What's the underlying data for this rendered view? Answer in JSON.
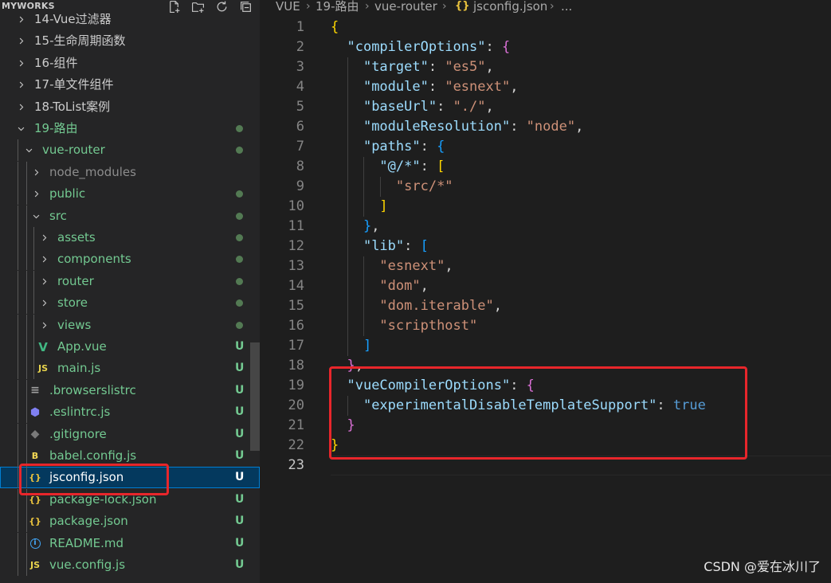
{
  "explorer": {
    "title": "MYWORKS",
    "actions": [
      "new-file-icon",
      "new-folder-icon",
      "refresh-icon",
      "collapse-all-icon"
    ],
    "items": [
      {
        "label": "14-Vue过滤器",
        "kind": "folder",
        "expanded": false,
        "level": 1,
        "status": ""
      },
      {
        "label": "15-生命周期函数",
        "kind": "folder",
        "expanded": false,
        "level": 1,
        "status": ""
      },
      {
        "label": "16-组件",
        "kind": "folder",
        "expanded": false,
        "level": 1,
        "status": ""
      },
      {
        "label": "17-单文件组件",
        "kind": "folder",
        "expanded": false,
        "level": 1,
        "status": ""
      },
      {
        "label": "18-ToList案例",
        "kind": "folder",
        "expanded": false,
        "level": 1,
        "status": ""
      },
      {
        "label": "19-路由",
        "kind": "folder",
        "expanded": true,
        "level": 1,
        "status": "dot"
      },
      {
        "label": "vue-router",
        "kind": "folder",
        "expanded": true,
        "level": 2,
        "status": "dot"
      },
      {
        "label": "node_modules",
        "kind": "folder",
        "expanded": false,
        "level": 3,
        "status": ""
      },
      {
        "label": "public",
        "kind": "folder",
        "expanded": false,
        "level": 3,
        "status": "dot"
      },
      {
        "label": "src",
        "kind": "folder",
        "expanded": true,
        "level": 3,
        "status": "dot"
      },
      {
        "label": "assets",
        "kind": "folder",
        "expanded": false,
        "level": 4,
        "status": "dot"
      },
      {
        "label": "components",
        "kind": "folder",
        "expanded": false,
        "level": 4,
        "status": "dot"
      },
      {
        "label": "router",
        "kind": "folder",
        "expanded": false,
        "level": 4,
        "status": "dot"
      },
      {
        "label": "store",
        "kind": "folder",
        "expanded": false,
        "level": 4,
        "status": "dot"
      },
      {
        "label": "views",
        "kind": "folder",
        "expanded": false,
        "level": 4,
        "status": "dot"
      },
      {
        "label": "App.vue",
        "kind": "file",
        "icon": "vue",
        "icon_text": "V",
        "level": 4,
        "status": "U"
      },
      {
        "label": "main.js",
        "kind": "file",
        "icon": "js",
        "icon_text": "JS",
        "level": 4,
        "status": "U"
      },
      {
        "label": ".browserslistrc",
        "kind": "file",
        "icon": "lines",
        "icon_text": "≡",
        "level": 3,
        "status": "U"
      },
      {
        "label": ".eslintrc.js",
        "kind": "file",
        "icon": "eslint",
        "icon_text": "⬢",
        "level": 3,
        "status": "U"
      },
      {
        "label": ".gitignore",
        "kind": "file",
        "icon": "git",
        "icon_text": "◆",
        "level": 3,
        "status": "U"
      },
      {
        "label": "babel.config.js",
        "kind": "file",
        "icon": "babel",
        "icon_text": "B",
        "level": 3,
        "status": "U"
      },
      {
        "label": "jsconfig.json",
        "kind": "file",
        "icon": "json",
        "icon_text": "{}",
        "level": 3,
        "status": "U",
        "selected": true
      },
      {
        "label": "package-lock.json",
        "kind": "file",
        "icon": "json",
        "icon_text": "{}",
        "level": 3,
        "status": "U"
      },
      {
        "label": "package.json",
        "kind": "file",
        "icon": "json",
        "icon_text": "{}",
        "level": 3,
        "status": "U"
      },
      {
        "label": "README.md",
        "kind": "file",
        "icon": "info",
        "icon_text": "i",
        "level": 3,
        "status": "U"
      },
      {
        "label": "vue.config.js",
        "kind": "file",
        "icon": "js",
        "icon_text": "JS",
        "level": 3,
        "status": "U"
      }
    ]
  },
  "breadcrumb": {
    "segments": [
      "VUE",
      "19-路由",
      "vue-router",
      "jsconfig.json",
      "..."
    ],
    "file_icon_text": "{}"
  },
  "editor": {
    "active_line": 23,
    "lines": [
      [
        [
          "{",
          "b1"
        ]
      ],
      [
        [
          "  ",
          "sp"
        ],
        [
          "\"compilerOptions\"",
          "key"
        ],
        [
          ": ",
          "punc"
        ],
        [
          "{",
          "b2"
        ]
      ],
      [
        [
          "    ",
          "sp"
        ],
        [
          "\"target\"",
          "key"
        ],
        [
          ": ",
          "punc"
        ],
        [
          "\"es5\"",
          "str"
        ],
        [
          ",",
          "punc"
        ]
      ],
      [
        [
          "    ",
          "sp"
        ],
        [
          "\"module\"",
          "key"
        ],
        [
          ": ",
          "punc"
        ],
        [
          "\"esnext\"",
          "str"
        ],
        [
          ",",
          "punc"
        ]
      ],
      [
        [
          "    ",
          "sp"
        ],
        [
          "\"baseUrl\"",
          "key"
        ],
        [
          ": ",
          "punc"
        ],
        [
          "\"./\"",
          "str"
        ],
        [
          ",",
          "punc"
        ]
      ],
      [
        [
          "    ",
          "sp"
        ],
        [
          "\"moduleResolution\"",
          "key"
        ],
        [
          ": ",
          "punc"
        ],
        [
          "\"node\"",
          "str"
        ],
        [
          ",",
          "punc"
        ]
      ],
      [
        [
          "    ",
          "sp"
        ],
        [
          "\"paths\"",
          "key"
        ],
        [
          ": ",
          "punc"
        ],
        [
          "{",
          "b3"
        ]
      ],
      [
        [
          "      ",
          "sp"
        ],
        [
          "\"@/*\"",
          "key"
        ],
        [
          ": ",
          "punc"
        ],
        [
          "[",
          "b1"
        ]
      ],
      [
        [
          "        ",
          "sp"
        ],
        [
          "\"src/*\"",
          "str"
        ]
      ],
      [
        [
          "      ",
          "sp"
        ],
        [
          "]",
          "b1"
        ]
      ],
      [
        [
          "    ",
          "sp"
        ],
        [
          "}",
          "b3"
        ],
        [
          ",",
          "punc"
        ]
      ],
      [
        [
          "    ",
          "sp"
        ],
        [
          "\"lib\"",
          "key"
        ],
        [
          ": ",
          "punc"
        ],
        [
          "[",
          "b3"
        ]
      ],
      [
        [
          "      ",
          "sp"
        ],
        [
          "\"esnext\"",
          "str"
        ],
        [
          ",",
          "punc"
        ]
      ],
      [
        [
          "      ",
          "sp"
        ],
        [
          "\"dom\"",
          "str"
        ],
        [
          ",",
          "punc"
        ]
      ],
      [
        [
          "      ",
          "sp"
        ],
        [
          "\"dom.iterable\"",
          "str"
        ],
        [
          ",",
          "punc"
        ]
      ],
      [
        [
          "      ",
          "sp"
        ],
        [
          "\"scripthost\"",
          "str"
        ]
      ],
      [
        [
          "    ",
          "sp"
        ],
        [
          "]",
          "b3"
        ]
      ],
      [
        [
          "  ",
          "sp"
        ],
        [
          "}",
          "b2"
        ],
        [
          ",",
          "punc"
        ]
      ],
      [
        [
          "  ",
          "sp"
        ],
        [
          "\"vueCompilerOptions\"",
          "key"
        ],
        [
          ": ",
          "punc"
        ],
        [
          "{",
          "b2"
        ]
      ],
      [
        [
          "    ",
          "sp"
        ],
        [
          "\"experimentalDisableTemplateSupport\"",
          "key"
        ],
        [
          ": ",
          "punc"
        ],
        [
          "true",
          "bool"
        ]
      ],
      [
        [
          "  ",
          "sp"
        ],
        [
          "}",
          "b2"
        ]
      ],
      [
        [
          "}",
          "b1"
        ]
      ],
      []
    ]
  },
  "watermark": "CSDN @爱在冰川了",
  "colors": {
    "annotation_red": "#e8262b",
    "git_untracked": "#73c991",
    "selection_bg": "#04395e"
  }
}
